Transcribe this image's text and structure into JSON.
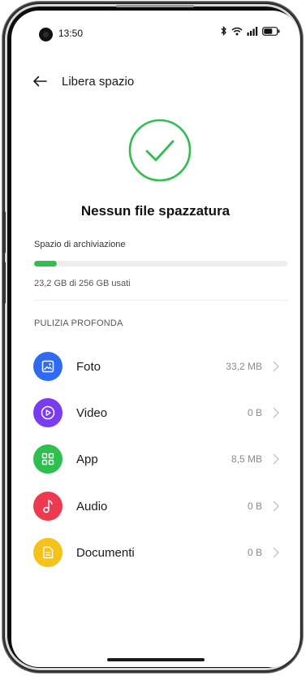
{
  "status_bar": {
    "time": "13:50",
    "icons": [
      "bluetooth-icon",
      "wifi-icon",
      "signal-icon",
      "battery-icon"
    ]
  },
  "header": {
    "back_icon": "arrow-left-icon",
    "title": "Libera spazio"
  },
  "result": {
    "icon": "check-circle-icon",
    "headline": "Nessun file spazzatura",
    "accent_color": "#2fbf4f"
  },
  "storage": {
    "label": "Spazio di archiviazione",
    "usage_text": "23,2 GB di 256 GB usati",
    "used_fraction": 0.09,
    "bar_color": "#2fbf4f"
  },
  "deep_clean": {
    "title": "PULIZIA PROFONDA",
    "items": [
      {
        "label": "Foto",
        "size": "33,2 MB",
        "icon": "image-icon",
        "color": "#2f6bf0"
      },
      {
        "label": "Video",
        "size": "0 B",
        "icon": "play-icon",
        "color": "#7a3cf0"
      },
      {
        "label": "App",
        "size": "8,5 MB",
        "icon": "apps-grid-icon",
        "color": "#2fbf4f"
      },
      {
        "label": "Audio",
        "size": "0 B",
        "icon": "music-note-icon",
        "color": "#ee3a4f"
      },
      {
        "label": "Documenti",
        "size": "0 B",
        "icon": "document-icon",
        "color": "#f5c21c"
      }
    ]
  }
}
